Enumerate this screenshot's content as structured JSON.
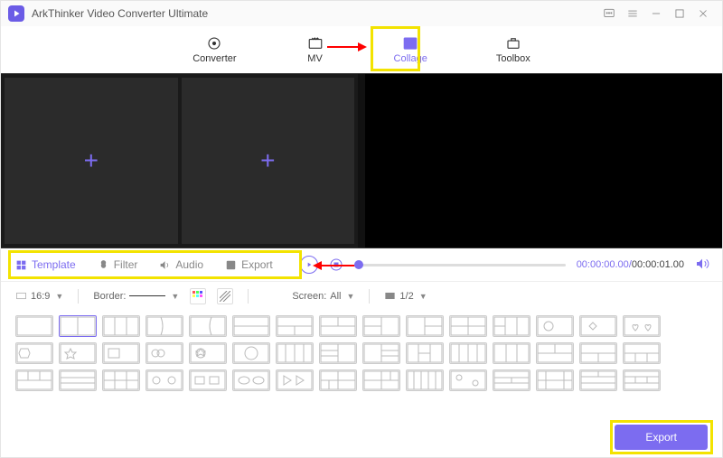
{
  "app_title": "ArkThinker Video Converter Ultimate",
  "nav": {
    "converter": "Converter",
    "mv": "MV",
    "collage": "Collage",
    "toolbox": "Toolbox"
  },
  "editor_tabs": {
    "template": "Template",
    "filter": "Filter",
    "audio": "Audio",
    "export": "Export"
  },
  "playback": {
    "current": "00:00:00.00",
    "total": "00:00:01.00"
  },
  "options": {
    "ratio": "16:9",
    "border_label": "Border:",
    "screen_label": "Screen:",
    "screen_value": "All",
    "page": "1/2"
  },
  "export_button": "Export"
}
